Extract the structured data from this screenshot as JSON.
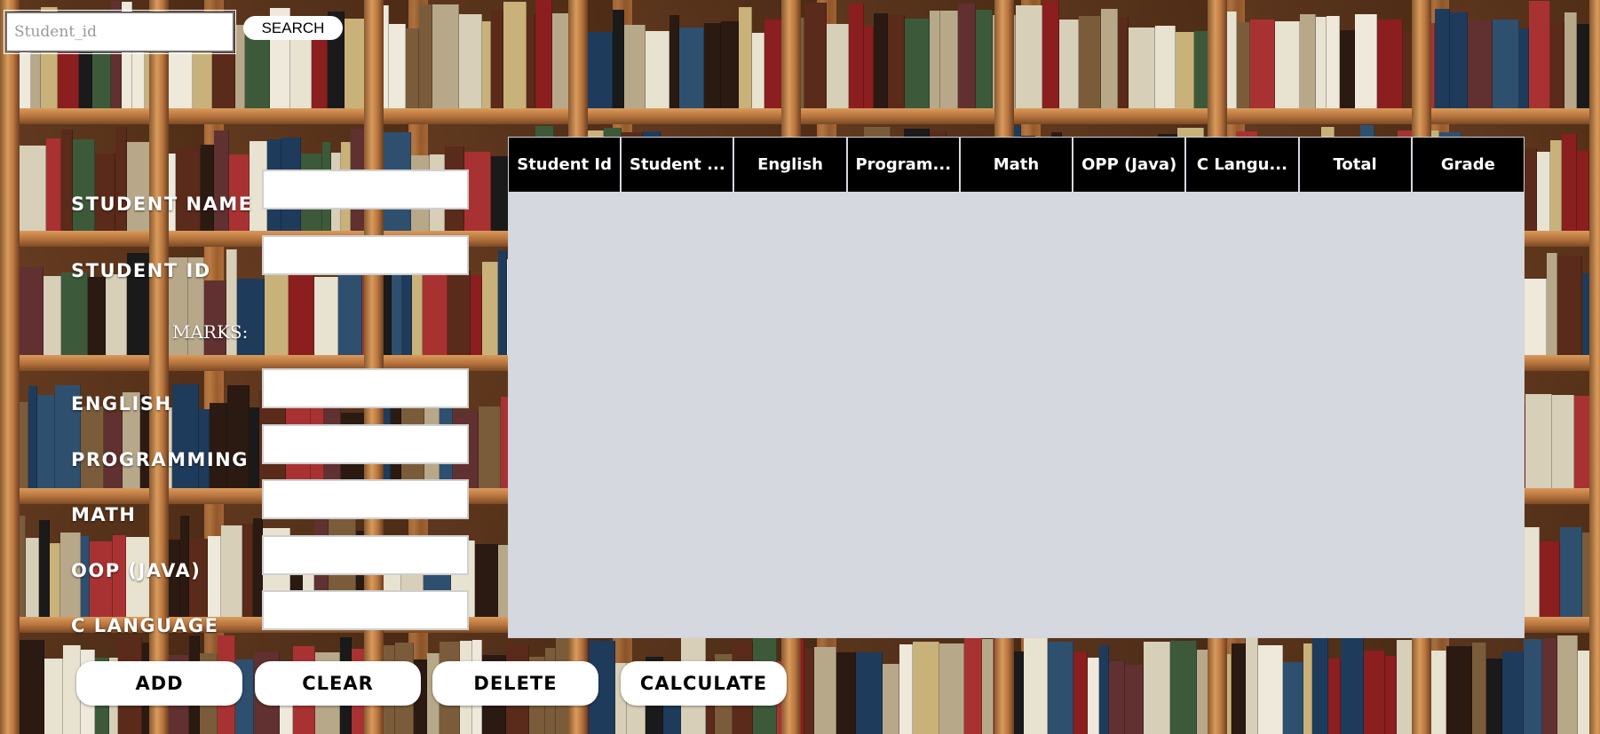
{
  "search": {
    "placeholder": "Student_id",
    "button_label": "SEARCH"
  },
  "form": {
    "student_name_label": "STUDENT NAME",
    "student_id_label": "STUDENT ID",
    "marks_label": "MARKS:",
    "english_label": "ENGLISH",
    "programming_label": "PROGRAMMING",
    "math_label": "MATH",
    "oop_label": "OOP (JAVA)",
    "c_language_label": "C LANGUAGE"
  },
  "table": {
    "columns": [
      "Student Id",
      "Student ...",
      "English",
      "Program...",
      "Math",
      "OPP (Java)",
      "C Langu...",
      "Total",
      "Grade"
    ],
    "rows": []
  },
  "actions": {
    "add_label": "ADD",
    "clear_label": "CLEAR",
    "delete_label": "DELETE",
    "calculate_label": "CALCULATE"
  },
  "colors": {
    "table_header_bg": "#000000",
    "table_body_bg": "#d5d8df",
    "label_text": "#ffffff"
  }
}
